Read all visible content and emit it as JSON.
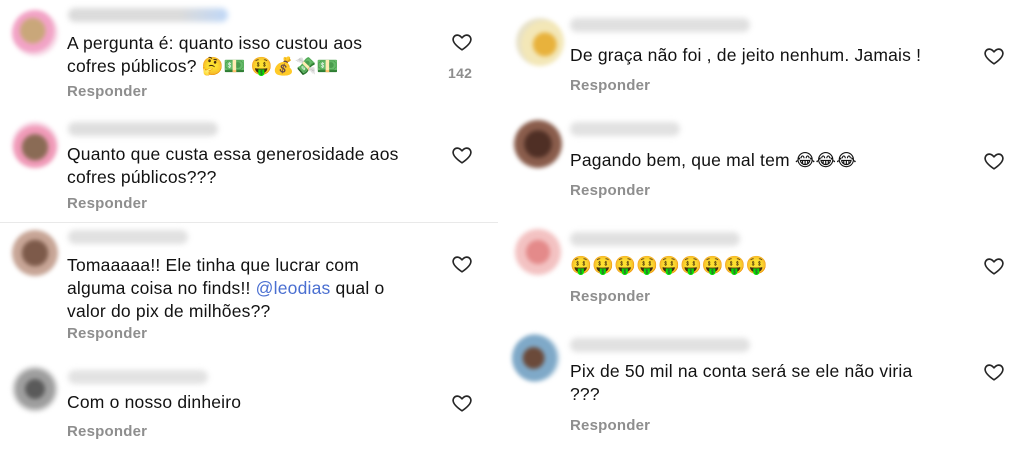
{
  "left": {
    "comments": [
      {
        "text": "A pergunta é: quanto isso custou aos cofres públicos? 🤔💵 🤑💰💸💵",
        "likes": "142",
        "reply": "Responder"
      },
      {
        "text": "Quanto que custa essa generosidade aos cofres públicos???",
        "reply": "Responder"
      },
      {
        "text_before": "Tomaaaaa!! Ele tinha que lucrar com alguma coisa no finds!! ",
        "mention": "@leodias",
        "text_after": " qual o valor do pix de milhões??",
        "reply": "Responder"
      },
      {
        "text": "Com o nosso dinheiro",
        "reply": "Responder"
      }
    ]
  },
  "right": {
    "comments": [
      {
        "text": "De graça não foi , de jeito nenhum. Jamais !",
        "reply": "Responder"
      },
      {
        "text": "Pagando bem, que mal tem 😂😂😂",
        "reply": "Responder"
      },
      {
        "text": "🤑🤑🤑🤑🤑🤑🤑🤑🤑",
        "reply": "Responder"
      },
      {
        "text": "Pix de 50 mil na conta será se ele não viria ???",
        "reply": "Responder"
      }
    ]
  },
  "icons": {
    "like": "heart-outline-icon"
  },
  "colors": {
    "text": "#121212",
    "secondary": "#8e8e8e",
    "mention": "#4a6fd1",
    "divider": "#e9e9e9"
  }
}
